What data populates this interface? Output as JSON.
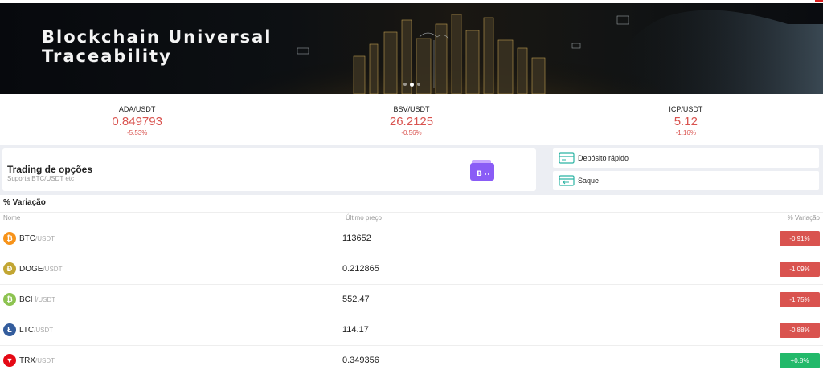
{
  "banner": {
    "title": "Blockchain Universal\nTraceability",
    "slides": 3,
    "active_slide": 2
  },
  "tickers": [
    {
      "pair": "ADA/USDT",
      "price": "0.849793",
      "change": "-5.53%"
    },
    {
      "pair": "BSV/USDT",
      "price": "26.2125",
      "change": "-0.56%"
    },
    {
      "pair": "ICP/USDT",
      "price": "5.12",
      "change": "-1.16%"
    }
  ],
  "options": {
    "title": "Trading de opções",
    "subtitle": "Suporta BTC/USDT etc"
  },
  "quick_actions": {
    "deposit_label": "Depósito rápido",
    "withdraw_label": "Saque"
  },
  "variation": {
    "title": "% Variação",
    "col_name": "Nome",
    "col_price": "Último preço",
    "col_change": "% Variação",
    "rows": [
      {
        "symbol": "BTC",
        "quote": "/USDT",
        "price": "113652",
        "change": "-0.91%",
        "direction": "down",
        "icon": "bitcoin-icon",
        "color": "#f7931a",
        "glyph": "₿"
      },
      {
        "symbol": "DOGE",
        "quote": "/USDT",
        "price": "0.212865",
        "change": "-1.09%",
        "direction": "down",
        "icon": "dogecoin-icon",
        "color": "#c2a633",
        "glyph": "Ð"
      },
      {
        "symbol": "BCH",
        "quote": "/USDT",
        "price": "552.47",
        "change": "-1.75%",
        "direction": "down",
        "icon": "bitcoin-cash-icon",
        "color": "#8dc351",
        "glyph": "₿"
      },
      {
        "symbol": "LTC",
        "quote": "/USDT",
        "price": "114.17",
        "change": "-0.88%",
        "direction": "down",
        "icon": "litecoin-icon",
        "color": "#345d9d",
        "glyph": "Ł"
      },
      {
        "symbol": "TRX",
        "quote": "/USDT",
        "price": "0.349356",
        "change": "+0.8%",
        "direction": "up",
        "icon": "tron-icon",
        "color": "#e50915",
        "glyph": "▼"
      }
    ]
  },
  "colors": {
    "negative": "#d9534f",
    "positive": "#22b96a",
    "accent": "#8a5cf6"
  }
}
